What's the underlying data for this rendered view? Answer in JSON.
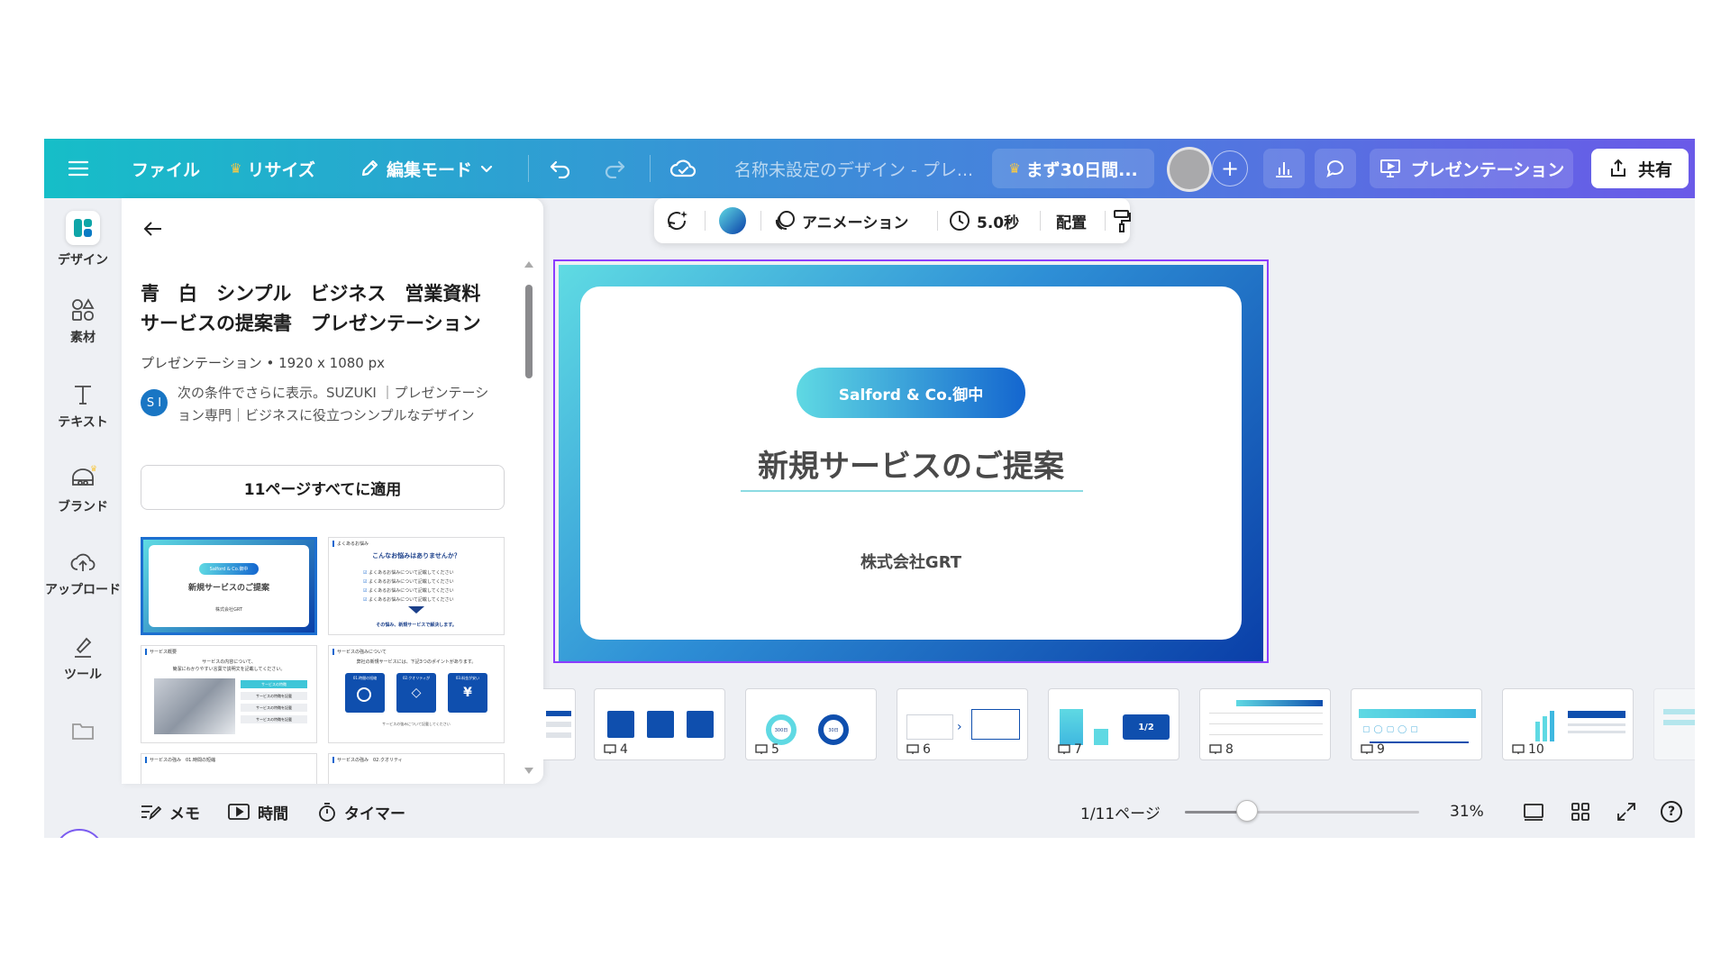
{
  "topbar": {
    "file": "ファイル",
    "resize": "リサイズ",
    "edit_mode": "編集モード",
    "doc_title": "名称未設定のデザイン - プレ...",
    "trial": "まず30日間...",
    "add": "+",
    "present": "プレゼンテーション",
    "share": "共有"
  },
  "rail": [
    {
      "label": "デザイン",
      "icon": "design-icon"
    },
    {
      "label": "素材",
      "icon": "elements-icon"
    },
    {
      "label": "テキスト",
      "icon": "text-icon"
    },
    {
      "label": "ブランド",
      "icon": "brand-icon"
    },
    {
      "label": "アップロード",
      "icon": "upload-icon"
    },
    {
      "label": "ツール",
      "icon": "tools-icon"
    }
  ],
  "panel": {
    "title_line1": "青　白　シンプル　ビジネス　営業資料",
    "title_line2": "サービスの提案書　プレゼンテーション",
    "meta": "プレゼンテーション • 1920 x 1080 px",
    "author_initials": "S I",
    "author_line1": "次の条件でさらに表示。SUZUKI ｜プレゼンテーシ",
    "author_line2": "ョン専門｜ビジネスに役立つシンプルなデザイン",
    "apply_button": "11ページすべてに適用",
    "thumbs": {
      "t1_pill": "Salford & Co.御中",
      "t1_title": "新規サービスのご提案",
      "t1_company": "株式会社GRT",
      "t2_tag": "よくあるお悩み",
      "t2_title": "こんなお悩みはありませんか？",
      "t2_item": "よくあるお悩みについて記載してください",
      "t2_footer": "その悩み、新規サービスで解決します。",
      "t3_tag": "サービス概要",
      "t3_line1": "サービスの内容について、",
      "t3_line2": "簡潔にわかりやすい言葉で説明文を記載してください。",
      "t3_row1": "サービスの特徴",
      "t3_row2": "サービスの特徴を記載",
      "t4_tag": "サービスの強みについて",
      "t4_line": "弊社の新規サービスには、下記3つのポイントがあります。",
      "t4_box1": "01.時間の短縮",
      "t4_box2": "02.クオリティが",
      "t4_box3": "03.料金が安い",
      "t4_caption": "サービスの強みについて記載してください",
      "t5_tag": "サービスの強み　01.時間の短縮",
      "t6_tag": "サービスの強み　02.クオリティ"
    }
  },
  "context_toolbar": {
    "animation": "アニメーション",
    "duration": "5.0秒",
    "position": "配置"
  },
  "slide": {
    "pill": "Salford & Co.御中",
    "heading": "新規サービスのご提案",
    "company": "株式会社GRT"
  },
  "filmstrip": [
    {
      "num": "4"
    },
    {
      "num": "5"
    },
    {
      "num": "6"
    },
    {
      "num": "7"
    },
    {
      "num": "8"
    },
    {
      "num": "9"
    },
    {
      "num": "10"
    }
  ],
  "filmstrip_details": {
    "f5_val1": "300日",
    "f5_val2": "30日",
    "f7_badge": "1/2"
  },
  "bottom": {
    "notes": "メモ",
    "duration": "時間",
    "timer": "タイマー",
    "page": "1/11ページ",
    "zoom_pct": "31%",
    "zoom_level": 0.31,
    "help": "?"
  },
  "colors": {
    "topbar_start": "#16bec8",
    "topbar_end": "#6a5ae8",
    "selection": "#8b3dff",
    "slide_blue": "#0a3fa8",
    "slide_cyan": "#5fdbe3"
  }
}
